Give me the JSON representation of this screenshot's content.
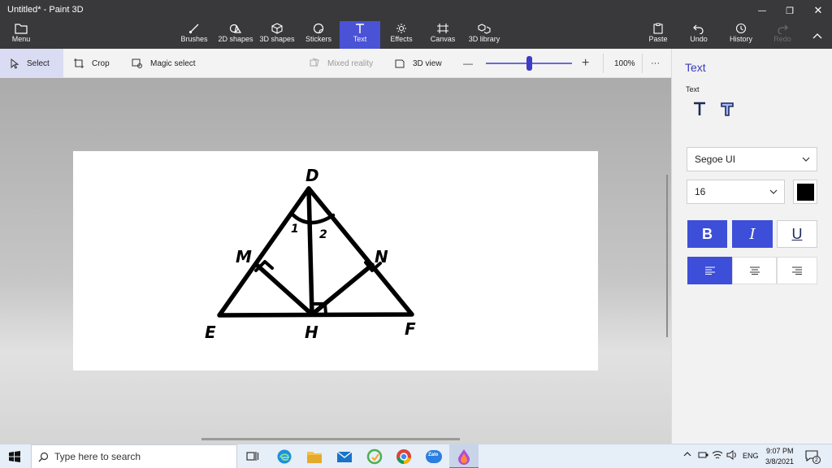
{
  "window": {
    "title": "Untitled* - Paint 3D",
    "minimize_glyph": "—",
    "restore_glyph": "❐",
    "close_glyph": "✕"
  },
  "ribbon": {
    "menu_label": "Menu",
    "tools": [
      {
        "label": "Brushes",
        "icon": "brush-icon"
      },
      {
        "label": "2D shapes",
        "icon": "2d-shapes-icon"
      },
      {
        "label": "3D shapes",
        "icon": "3d-shapes-icon"
      },
      {
        "label": "Stickers",
        "icon": "stickers-icon"
      },
      {
        "label": "Text",
        "icon": "text-icon",
        "active": true
      },
      {
        "label": "Effects",
        "icon": "effects-icon"
      },
      {
        "label": "Canvas",
        "icon": "canvas-icon"
      },
      {
        "label": "3D library",
        "icon": "3d-library-icon"
      }
    ],
    "paste_label": "Paste",
    "undo_label": "Undo",
    "history_label": "History",
    "redo_label": "Redo"
  },
  "toolbar": {
    "select_label": "Select",
    "crop_label": "Crop",
    "magic_select_label": "Magic select",
    "mixed_reality_label": "Mixed reality",
    "view3d_label": "3D view",
    "zoom_minus": "—",
    "zoom_plus": "+",
    "zoom_value": "100%",
    "zoom_fraction": 0.5,
    "more_label": "···"
  },
  "drawing": {
    "labels": {
      "D": "D",
      "E": "E",
      "F": "F",
      "H": "H",
      "M": "M",
      "N": "N",
      "angle1": "1",
      "angle2": "2"
    }
  },
  "panel": {
    "heading": "Text",
    "subheading": "Text",
    "font_name": "Segoe UI",
    "font_size": "16",
    "color_swatch": "#000000",
    "bold_label": "B",
    "italic_label": "I",
    "underline_label": "U",
    "accent": "#3d4fd8"
  },
  "taskbar": {
    "search_placeholder": "Type here to search",
    "language": "ENG",
    "time": "9:07 PM",
    "date": "3/8/2021",
    "notification_count": "2",
    "zalo_label": "Zalo"
  }
}
